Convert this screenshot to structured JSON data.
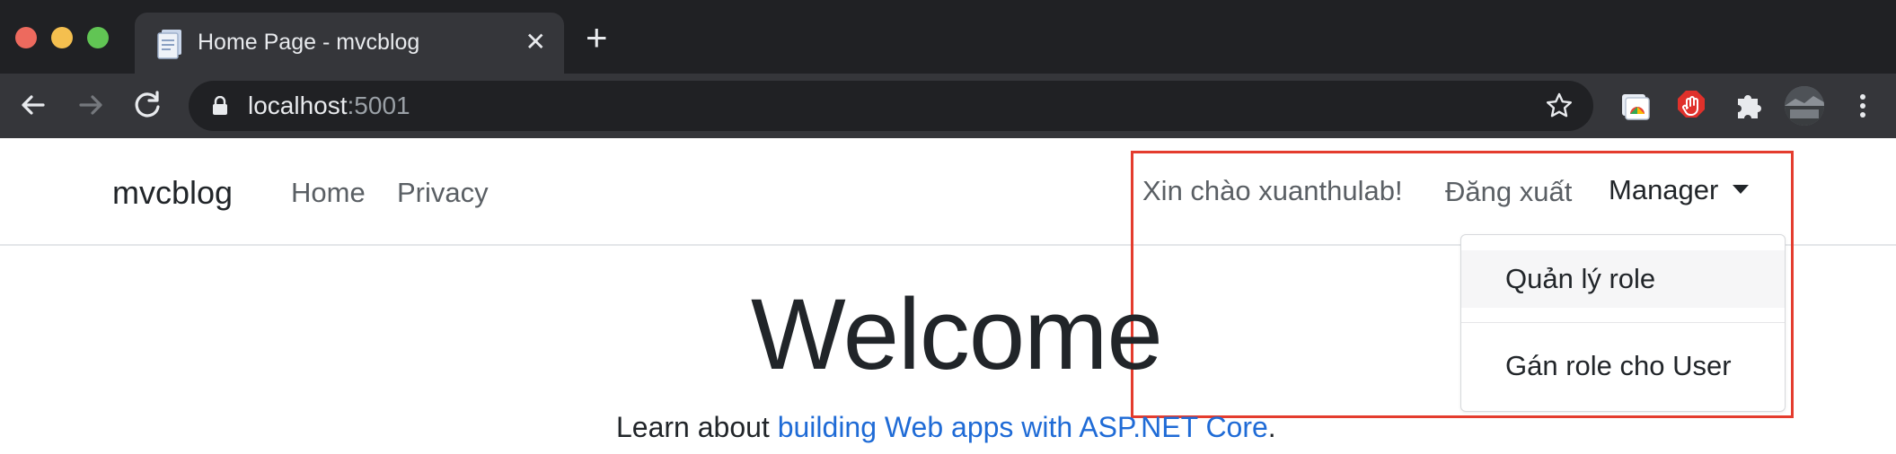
{
  "browser": {
    "tab_title": "Home Page - mvcblog",
    "tab_close": "✕",
    "new_tab": "+",
    "url_host": "localhost",
    "url_port": ":5001"
  },
  "navbar": {
    "brand": "mvcblog",
    "links": [
      "Home",
      "Privacy"
    ],
    "greeting": "Xin chào xuanthulab!",
    "logout": "Đăng xuất",
    "manager": "Manager"
  },
  "dropdown": {
    "items": [
      "Quản lý role",
      "Gán role cho User"
    ]
  },
  "main": {
    "heading": "Welcome",
    "learn_prefix": "Learn about ",
    "learn_link": "building Web apps with ASP.NET Core",
    "learn_suffix": "."
  },
  "colors": {
    "highlight_border": "#e43c2e",
    "link": "#1f6bd6",
    "chrome_dark": "#202124"
  },
  "icons": [
    "back-arrow-icon",
    "forward-arrow-icon",
    "reload-icon",
    "lock-icon",
    "star-icon",
    "extension-icon",
    "puzzle-icon",
    "profile-avatar"
  ]
}
